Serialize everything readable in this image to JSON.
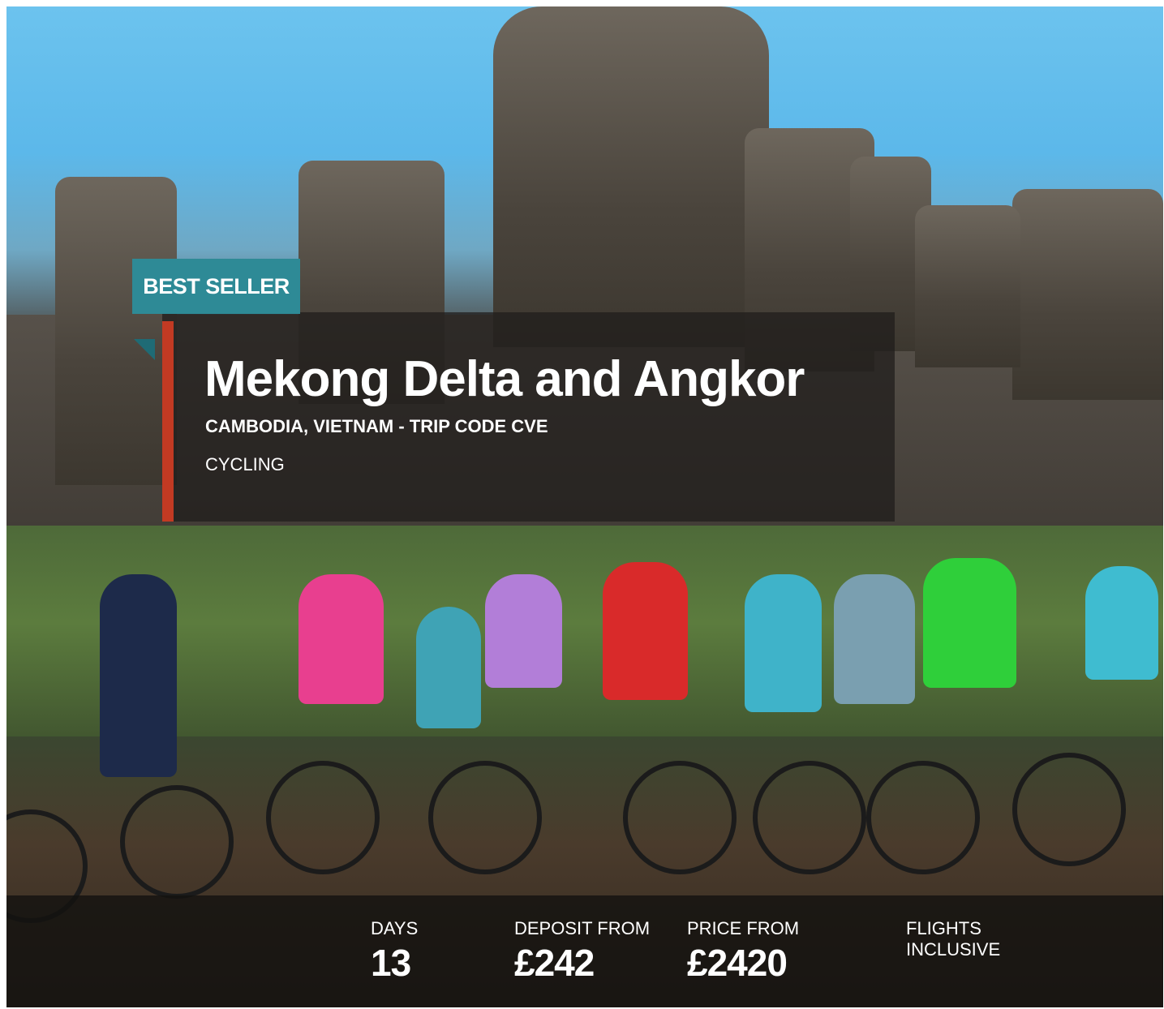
{
  "badge": {
    "label": "BEST SELLER"
  },
  "trip": {
    "title": "Mekong Delta and Angkor",
    "subtitle": "CAMBODIA, VIETNAM - TRIP CODE CVE",
    "activity": "CYCLING"
  },
  "stats": {
    "days_label": "DAYS",
    "days_value": "13",
    "deposit_label": "DEPOSIT FROM",
    "deposit_value": "£242",
    "price_label": "PRICE FROM",
    "price_value": "£2420",
    "flights_line1": "FLIGHTS",
    "flights_line2": "INCLUSIVE"
  },
  "colors": {
    "badge": "#2e8a96",
    "accent_bar": "#c23a23"
  }
}
